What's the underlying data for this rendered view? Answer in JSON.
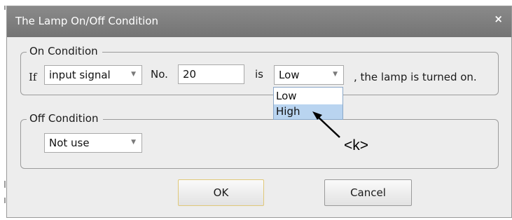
{
  "dialog": {
    "title": "The Lamp On/Off Condition",
    "close_label": "×"
  },
  "on_condition": {
    "legend": "On Condition",
    "if_label": "If",
    "signal_type": "input signal",
    "no_label": "No.",
    "number_value": "20",
    "is_label": "is",
    "level_value": "Low",
    "suffix_text": ", the lamp is turned on.",
    "dropdown_options": [
      "Low",
      "High"
    ],
    "highlighted_option": "High"
  },
  "off_condition": {
    "legend": "Off Condition",
    "mode_value": "Not use"
  },
  "buttons": {
    "ok_label": "OK",
    "cancel_label": "Cancel"
  },
  "annotation": {
    "label": "<k>"
  },
  "icons": {
    "dropdown_arrow": "chevron-down-icon",
    "pointer_arrow": "arrow-icon",
    "close": "close-icon"
  },
  "colors": {
    "titlebar": "#7d7d7d",
    "dialog_bg": "#ededed",
    "highlight": "#b9d4f0",
    "default_button_border": "#e0c878"
  }
}
